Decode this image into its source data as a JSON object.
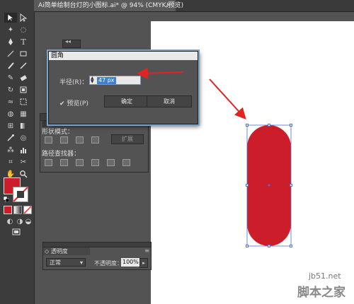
{
  "document": {
    "tab_title": "Ai简单绘制台灯的小图标.ai* @ 94% (CMYK/预览)",
    "close_label": "×"
  },
  "pathfinder": {
    "shape_modes_label": "形状模式：",
    "expand_label": "扩展",
    "pathfinder_label": "路径查找器："
  },
  "transparency": {
    "title": "◇ 透明度",
    "blend_mode": "正常",
    "opacity_label": "不透明度：",
    "opacity_value": "100%"
  },
  "dialog": {
    "title": "圆角",
    "radius_label": "半径(R)：",
    "radius_value": "47 px",
    "preview_label": "✔ 预览(P)",
    "ok_label": "确定",
    "cancel_label": "取消"
  },
  "watermark": {
    "site": "jb51.net",
    "name": "脚本之家"
  },
  "colors": {
    "fill": "#cc1e2a",
    "arrow": "#e52222",
    "selection": "#4a6fd8"
  }
}
